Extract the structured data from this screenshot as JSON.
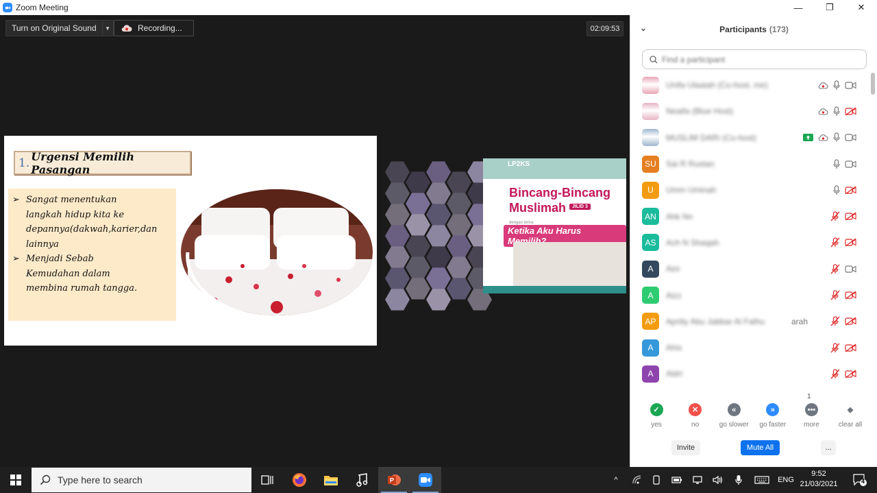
{
  "window": {
    "title": "Zoom Meeting",
    "minimize": "—",
    "restore": "❐",
    "close": "✕"
  },
  "meeting": {
    "original_sound_label": "Turn on Original Sound",
    "recording_label": "Recording...",
    "timer": "02:09:53"
  },
  "slide": {
    "number": "1.",
    "title": "Urgensi Memilih Pasangan",
    "bullet_marker": "➢",
    "bullets": [
      [
        "Sangat menentukan",
        "langkah hidup kita ke",
        "depannya(dakwah,karier,dan",
        "lainnya"
      ],
      [
        "Menjadi Sebab",
        "Kemudahan dalam",
        "membina rumah tangga."
      ]
    ]
  },
  "banner": {
    "org": "LP2KS",
    "headline1": "Bincang-Bincang",
    "headline2": "Muslimah",
    "jilid": "JILID 3",
    "theme_label": "dengan tema:",
    "quote": "Ketika Aku Harus Memilih?"
  },
  "participants": {
    "title": "Participants",
    "count": "(173)",
    "search_placeholder": "Find a participant",
    "rows": [
      {
        "initials": "",
        "name": "Unifa Ulaaiah (Co-host, me)",
        "color": "#e8a7b8",
        "photo": true,
        "share": false,
        "rec": true,
        "mic": "on",
        "video": "on"
      },
      {
        "initials": "",
        "name": "Neaifa (Blue Host)",
        "color": "#e6b5c4",
        "photo": true,
        "share": false,
        "rec": true,
        "mic": "on",
        "video": "off"
      },
      {
        "initials": "",
        "name": "MUSLIM DARI (Co-host)",
        "color": "#9fb6cc",
        "photo": true,
        "share": true,
        "rec": true,
        "mic": "on",
        "video": "on"
      },
      {
        "initials": "SU",
        "name": "Sai R Rustan",
        "color": "#e67e22",
        "photo": false,
        "mic": "on",
        "video": "on"
      },
      {
        "initials": "U",
        "name": "Umm Uminah",
        "color": "#f39c12",
        "photo": false,
        "mic": "on",
        "video": "off"
      },
      {
        "initials": "AN",
        "name": "Ahk Nn",
        "color": "#1abc9c",
        "photo": false,
        "mic": "off",
        "video": "off"
      },
      {
        "initials": "AS",
        "name": "Ach N Shaqah",
        "color": "#1abc9c",
        "photo": false,
        "mic": "off",
        "video": "off"
      },
      {
        "initials": "A",
        "name": "Aini",
        "color": "#34495e",
        "photo": false,
        "mic": "off",
        "video": "on"
      },
      {
        "initials": "A",
        "name": "Aizz",
        "color": "#2ecc71",
        "photo": false,
        "mic": "off",
        "video": "off"
      },
      {
        "initials": "AP",
        "name": "Apriliy Abu Jabbar Al Fathu",
        "clear_suffix": "arah",
        "color": "#f39c12",
        "photo": false,
        "mic": "off",
        "video": "off"
      },
      {
        "initials": "A",
        "name": "Ahis",
        "color": "#3498db",
        "photo": false,
        "mic": "off",
        "video": "off"
      },
      {
        "initials": "A",
        "name": "Aldri",
        "color": "#8e44ad",
        "photo": false,
        "mic": "off",
        "video": "off"
      }
    ],
    "reactions": [
      {
        "label": "yes",
        "glyph": "✓",
        "color": "#1aa653"
      },
      {
        "label": "no",
        "glyph": "✕",
        "color": "#f0504a"
      },
      {
        "label": "go slower",
        "glyph": "«",
        "color": "#6e7680"
      },
      {
        "label": "go faster",
        "glyph": "»",
        "color": "#2d8cff"
      },
      {
        "label": "more",
        "glyph": "•••",
        "color": "#6e7680"
      },
      {
        "label": "clear all",
        "glyph": "◆",
        "color": "#ffffff"
      }
    ],
    "more_count": "1",
    "invite_label": "Invite",
    "mute_all_label": "Mute All",
    "more_label": "..."
  },
  "taskbar": {
    "search_placeholder": "Type here to search",
    "language": "ENG",
    "time": "9:52",
    "date": "21/03/2021",
    "notifications": "4"
  }
}
